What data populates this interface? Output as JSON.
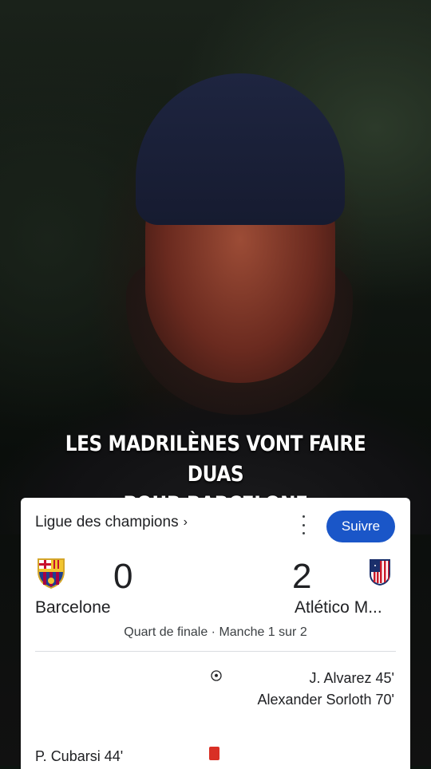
{
  "caption": {
    "line1": "LES MADRILÈNES VONT FAIRE DUAS",
    "line2": "POUR BARCELONE"
  },
  "match_card": {
    "competition": "Ligue des champions",
    "competition_chevron": "›",
    "follow_label": "Suivre",
    "home": {
      "name": "Barcelone",
      "score": "0",
      "crest_icon": "fc-barcelona-crest-icon"
    },
    "away": {
      "name": "Atlético M...",
      "score": "2",
      "crest_icon": "atletico-madrid-crest-icon"
    },
    "stage": "Quart de finale · Manche 1 sur 2",
    "events": {
      "away_goal_1": "J. Alvarez 45'",
      "away_goal_2": "Alexander Sorloth 70'",
      "home_red_card": "P. Cubarsi 44'"
    }
  },
  "colors": {
    "follow_button": "#1a56c8",
    "red_card": "#d93025",
    "card_background": "#ffffff"
  }
}
